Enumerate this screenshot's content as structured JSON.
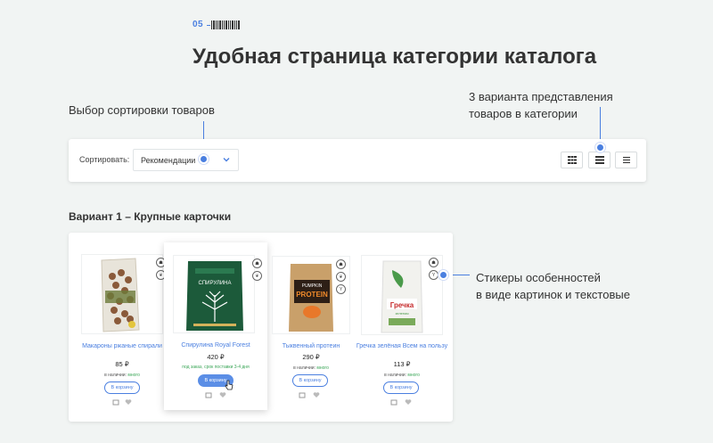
{
  "header": {
    "number": "05",
    "title": "Удобная страница категории каталога"
  },
  "annotations": {
    "sorting": "Выбор сортировки товаров",
    "views_line1": "3 варианта представления",
    "views_line2": "товаров в категории",
    "stickers_line1": "Стикеры особенностей",
    "stickers_line2": "в виде картинок и текстовые"
  },
  "sortbar": {
    "label": "Сортировать:",
    "selected": "Рекомендации",
    "view_buttons": [
      "grid-view-icon",
      "list-view-icon",
      "compact-list-icon"
    ]
  },
  "variant": {
    "title": "Вариант 1 – Крупные карточки"
  },
  "products": [
    {
      "name": "Макароны ржаные спирали",
      "price": "85 ₽",
      "stock_label": "в наличии:",
      "stock_value": "много",
      "cart": "В корзину"
    },
    {
      "name": "Спирулина Royal Forest",
      "price": "420 ₽",
      "order_note": "под заказ, срок поставки 3-4 дня",
      "cart": "В корзину"
    },
    {
      "name": "Тыквенный протеин",
      "price": "290 ₽",
      "stock_label": "в наличии:",
      "stock_value": "много",
      "cart": "В корзину"
    },
    {
      "name": "Гречка зелёная Всем на пользу",
      "price": "113 ₽",
      "stock_label": "в наличии:",
      "stock_value": "много",
      "cart": "В корзину"
    }
  ],
  "package_text": {
    "spirulina": "СПИРУЛИНА",
    "protein_top": "PUMPKIN",
    "protein_main": "PROTEIN",
    "buckwheat": "Гречка",
    "buckwheat_sub": "зеленая"
  },
  "colors": {
    "accent": "#4a7fe0",
    "in_stock": "#3aa657",
    "background": "#f1f4f3"
  }
}
